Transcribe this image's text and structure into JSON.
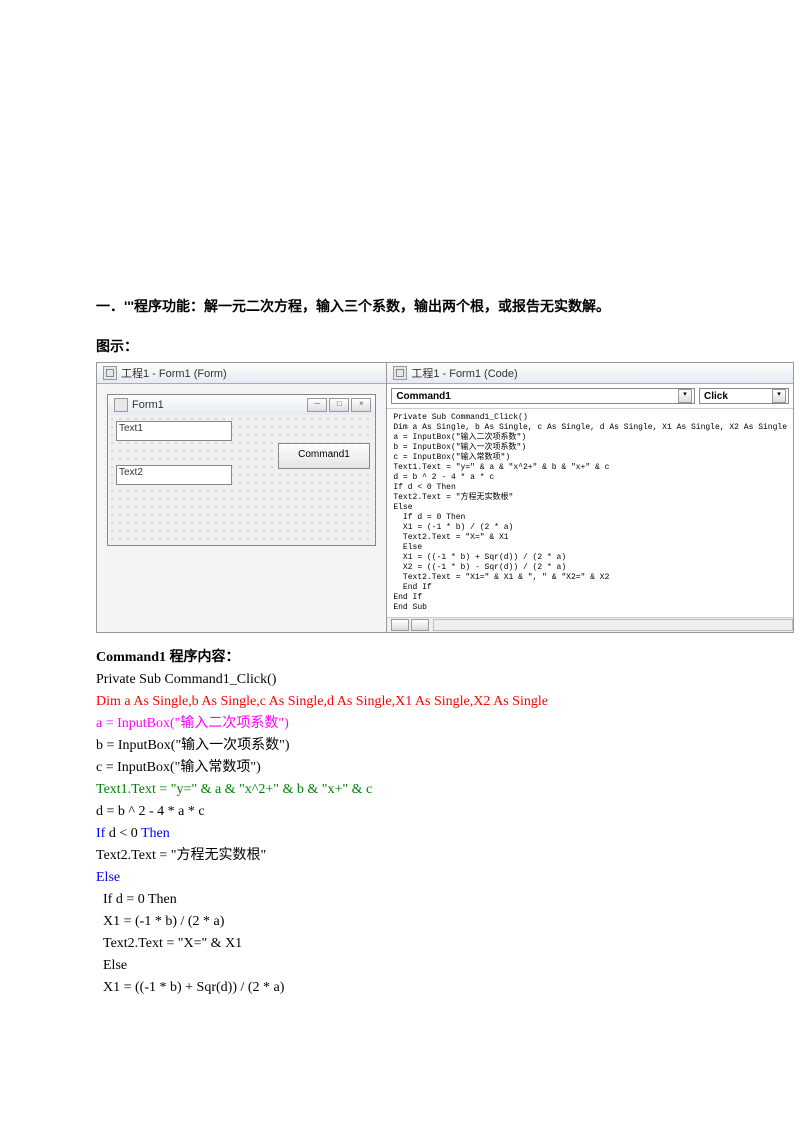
{
  "heading": "一．'''程序功能：解一元二次方程，输入三个系数，输出两个根，或报告无实数解。",
  "subheading": "图示：",
  "ide": {
    "form_pane_title": "工程1 - Form1 (Form)",
    "code_pane_title": "工程1 - Form1 (Code)",
    "form_title": "Form1",
    "text1_label": "Text1",
    "text2_label": "Text2",
    "cmd_label": "Command1",
    "combo_object": "Command1",
    "combo_proc": "Click",
    "code_pane_code": "Private Sub Command1_Click()\nDim a As Single, b As Single, c As Single, d As Single, X1 As Single, X2 As Single\na = InputBox(\"输入二次项系数\")\nb = InputBox(\"输入一次项系数\")\nc = InputBox(\"输入常数项\")\nText1.Text = \"y=\" & a & \"x^2+\" & b & \"x+\" & c\nd = b ^ 2 - 4 * a * c\nIf d < 0 Then\nText2.Text = \"方程无实数根\"\nElse\n  If d = 0 Then\n  X1 = (-1 * b) / (2 * a)\n  Text2.Text = \"X=\" & X1\n  Else\n  X1 = ((-1 * b) + Sqr(d)) / (2 * a)\n  X2 = ((-1 * b) - Sqr(d)) / (2 * a)\n  Text2.Text = \"X1=\" & X1 & \", \" & \"X2=\" & X2\n  End If\nEnd If\nEnd Sub"
  },
  "listing": {
    "title": "Command1 程序内容：",
    "line1": "Private Sub Command1_Click()",
    "line2": "Dim a As Single,b As Single,c As Single,d As Single,X1 As Single,X2 As Single",
    "line3": "a = InputBox(\"输入二次项系数\")",
    "line4": "b = InputBox(\"输入一次项系数\")",
    "line5": "c = InputBox(\"输入常数项\")",
    "line6": "Text1.Text = \"y=\" & a & \"x^2+\" & b & \"x+\" & c",
    "line7": "d = b ^ 2 - 4 * a * c",
    "line8a": "If",
    "line8b": " d < 0 ",
    "line8c": "Then",
    "line9": "Text2.Text = \"方程无实数根\"",
    "line10": "Else",
    "line11": "  If d = 0 Then",
    "line12": "  X1 = (-1 * b) / (2 * a)",
    "line13": "  Text2.Text = \"X=\" & X1",
    "line14": "  Else",
    "line15": "  X1 = ((-1 * b) + Sqr(d)) / (2 * a)"
  }
}
